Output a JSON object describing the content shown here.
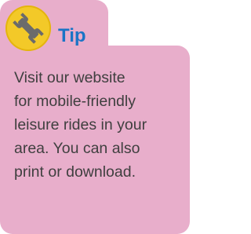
{
  "tip": {
    "icon": "wrench-icon",
    "title": "Tip",
    "body_lines": [
      "Visit our website",
      "for mobile-friendly",
      "leisure rides in your",
      "area. You can also",
      "print or download."
    ]
  },
  "colors": {
    "card": "#e8aecb",
    "badge": "#f3c928",
    "title": "#1a74c6",
    "text": "#3f3f3f",
    "wrench": "#6b6b6b"
  }
}
